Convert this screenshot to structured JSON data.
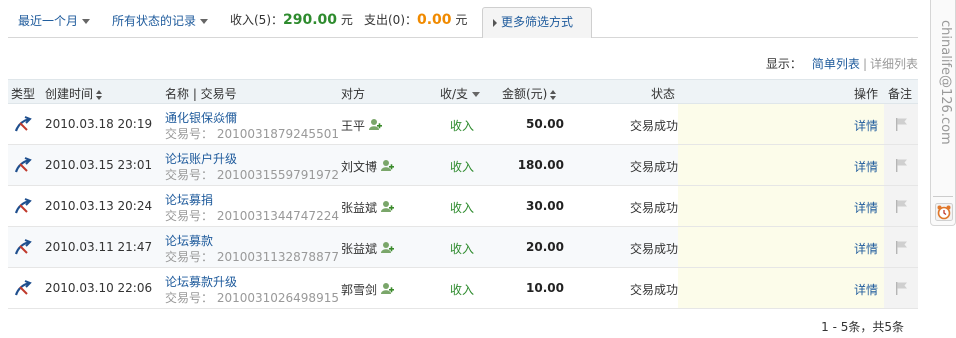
{
  "filters": {
    "period": "最近一个月",
    "status": "所有状态的记录",
    "income_label": "收入(5)：",
    "income_amount": "290.00",
    "income_unit": "元",
    "expense_label": "支出(0)：",
    "expense_amount": "0.00",
    "expense_unit": "元",
    "more_filters": "更多筛选方式"
  },
  "view_switch": {
    "label": "显示：",
    "simple": "简单列表",
    "separator": "|",
    "detailed": "详细列表"
  },
  "table": {
    "headers": {
      "type": "类型",
      "created": "创建时间",
      "name": "名称 | 交易号",
      "party": "对方",
      "inout": "收/支",
      "amount": "金额(元)",
      "status": "状态",
      "action": "操作",
      "note": "备注"
    },
    "rows": [
      {
        "time": "2010.03.18 20:19",
        "name": "通化银保焱儞",
        "txno": "交易号： 2010031879245501",
        "party": "王平",
        "inout": "收入",
        "amount": "50.00",
        "status": "交易成功",
        "detail": "详情"
      },
      {
        "time": "2010.03.15 23:01",
        "name": "论坛账户升级",
        "txno": "交易号： 2010031559791972",
        "party": "刘文博",
        "inout": "收入",
        "amount": "180.00",
        "status": "交易成功",
        "detail": "详情"
      },
      {
        "time": "2010.03.13 20:24",
        "name": "论坛募捐",
        "txno": "交易号： 2010031344747224",
        "party": "张益斌",
        "inout": "收入",
        "amount": "30.00",
        "status": "交易成功",
        "detail": "详情"
      },
      {
        "time": "2010.03.11 21:47",
        "name": "论坛募款",
        "txno": "交易号： 2010031132878877",
        "party": "张益斌",
        "inout": "收入",
        "amount": "20.00",
        "status": "交易成功",
        "detail": "详情"
      },
      {
        "time": "2010.03.10 22:06",
        "name": "论坛募款升级",
        "txno": "交易号： 2010031026498915",
        "party": "郭雪剑",
        "inout": "收入",
        "amount": "10.00",
        "status": "交易成功",
        "detail": "详情"
      }
    ]
  },
  "pager": {
    "summary": "1 - 5条，共5条"
  },
  "sidebar": {
    "account": "chinalife@126.com"
  },
  "icons": {
    "transaction_type": "transfer-arrow-icon",
    "add_contact": "add-contact-icon",
    "note_flag": "flag-icon",
    "alarm": "alarm-clock-icon"
  },
  "colors": {
    "link": "#1f5b9c",
    "income": "#2e8b2e",
    "expense": "#f08a00",
    "header_bg": "#eef3f6",
    "status_bg": "#fcfcea"
  }
}
